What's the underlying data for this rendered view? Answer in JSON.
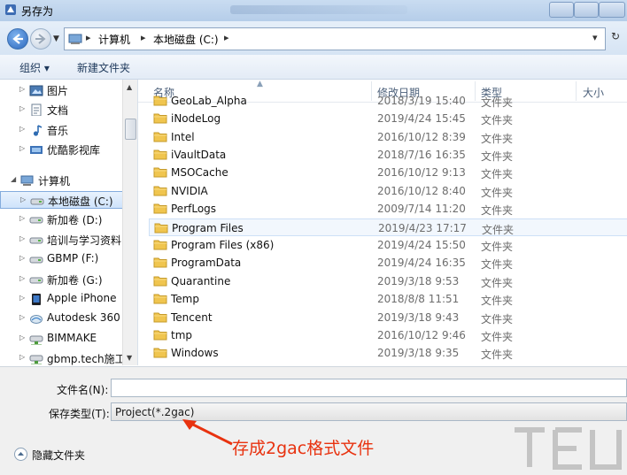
{
  "window": {
    "title": "另存为"
  },
  "address": {
    "crumbs": [
      "计算机",
      "本地磁盘 (C:)"
    ]
  },
  "toolbar": {
    "organize": "组织 ▾",
    "new_folder": "新建文件夹"
  },
  "nav": {
    "items": [
      {
        "label": "图片",
        "icon": "pictures-icon"
      },
      {
        "label": "文档",
        "icon": "documents-icon"
      },
      {
        "label": "音乐",
        "icon": "music-icon"
      },
      {
        "label": "优酷影视库",
        "icon": "library-icon"
      },
      {
        "label": "计算机",
        "icon": "computer-icon"
      },
      {
        "label": "本地磁盘 (C:)",
        "icon": "drive-icon",
        "selected": true
      },
      {
        "label": "新加卷 (D:)",
        "icon": "drive-icon"
      },
      {
        "label": "培训与学习资料",
        "icon": "drive-icon"
      },
      {
        "label": "GBMP (F:)",
        "icon": "drive-icon"
      },
      {
        "label": "新加卷 (G:)",
        "icon": "drive-icon"
      },
      {
        "label": "Apple iPhone",
        "icon": "phone-icon"
      },
      {
        "label": "Autodesk 360",
        "icon": "cloud-icon"
      },
      {
        "label": "BIMMAKE",
        "icon": "network-drive-icon"
      },
      {
        "label": "gbmp.tech施工",
        "icon": "network-drive-icon"
      }
    ]
  },
  "columns": {
    "name": "名称",
    "date": "修改日期",
    "type": "类型",
    "size": "大小"
  },
  "files": [
    {
      "name": "GeoLab_Alpha",
      "date": "2018/3/19 15:40",
      "type": "文件夹"
    },
    {
      "name": "iNodeLog",
      "date": "2019/4/24 15:45",
      "type": "文件夹"
    },
    {
      "name": "Intel",
      "date": "2016/10/12 8:39",
      "type": "文件夹"
    },
    {
      "name": "iVaultData",
      "date": "2018/7/16 16:35",
      "type": "文件夹"
    },
    {
      "name": "MSOCache",
      "date": "2016/10/12 9:13",
      "type": "文件夹"
    },
    {
      "name": "NVIDIA",
      "date": "2016/10/12 8:40",
      "type": "文件夹"
    },
    {
      "name": "PerfLogs",
      "date": "2009/7/14 11:20",
      "type": "文件夹"
    },
    {
      "name": "Program Files",
      "date": "2019/4/23 17:17",
      "type": "文件夹",
      "highlighted": true
    },
    {
      "name": "Program Files (x86)",
      "date": "2019/4/24 15:50",
      "type": "文件夹"
    },
    {
      "name": "ProgramData",
      "date": "2019/4/24 16:35",
      "type": "文件夹"
    },
    {
      "name": "Quarantine",
      "date": "2019/3/18 9:53",
      "type": "文件夹"
    },
    {
      "name": "Temp",
      "date": "2018/8/8 11:51",
      "type": "文件夹"
    },
    {
      "name": "Tencent",
      "date": "2019/3/18 9:43",
      "type": "文件夹"
    },
    {
      "name": "tmp",
      "date": "2016/10/12 9:46",
      "type": "文件夹"
    },
    {
      "name": "Windows",
      "date": "2019/3/18 9:35",
      "type": "文件夹"
    }
  ],
  "save": {
    "filename_label": "文件名(N):",
    "filename_value": "",
    "type_label": "保存类型(T):",
    "type_value": "Project(*.2gac)"
  },
  "annotation": "存成2gac格式文件",
  "hide_folders": "隐藏文件夹",
  "colors": {
    "annotation": "#e8320f",
    "folder": "#f0c54f"
  }
}
